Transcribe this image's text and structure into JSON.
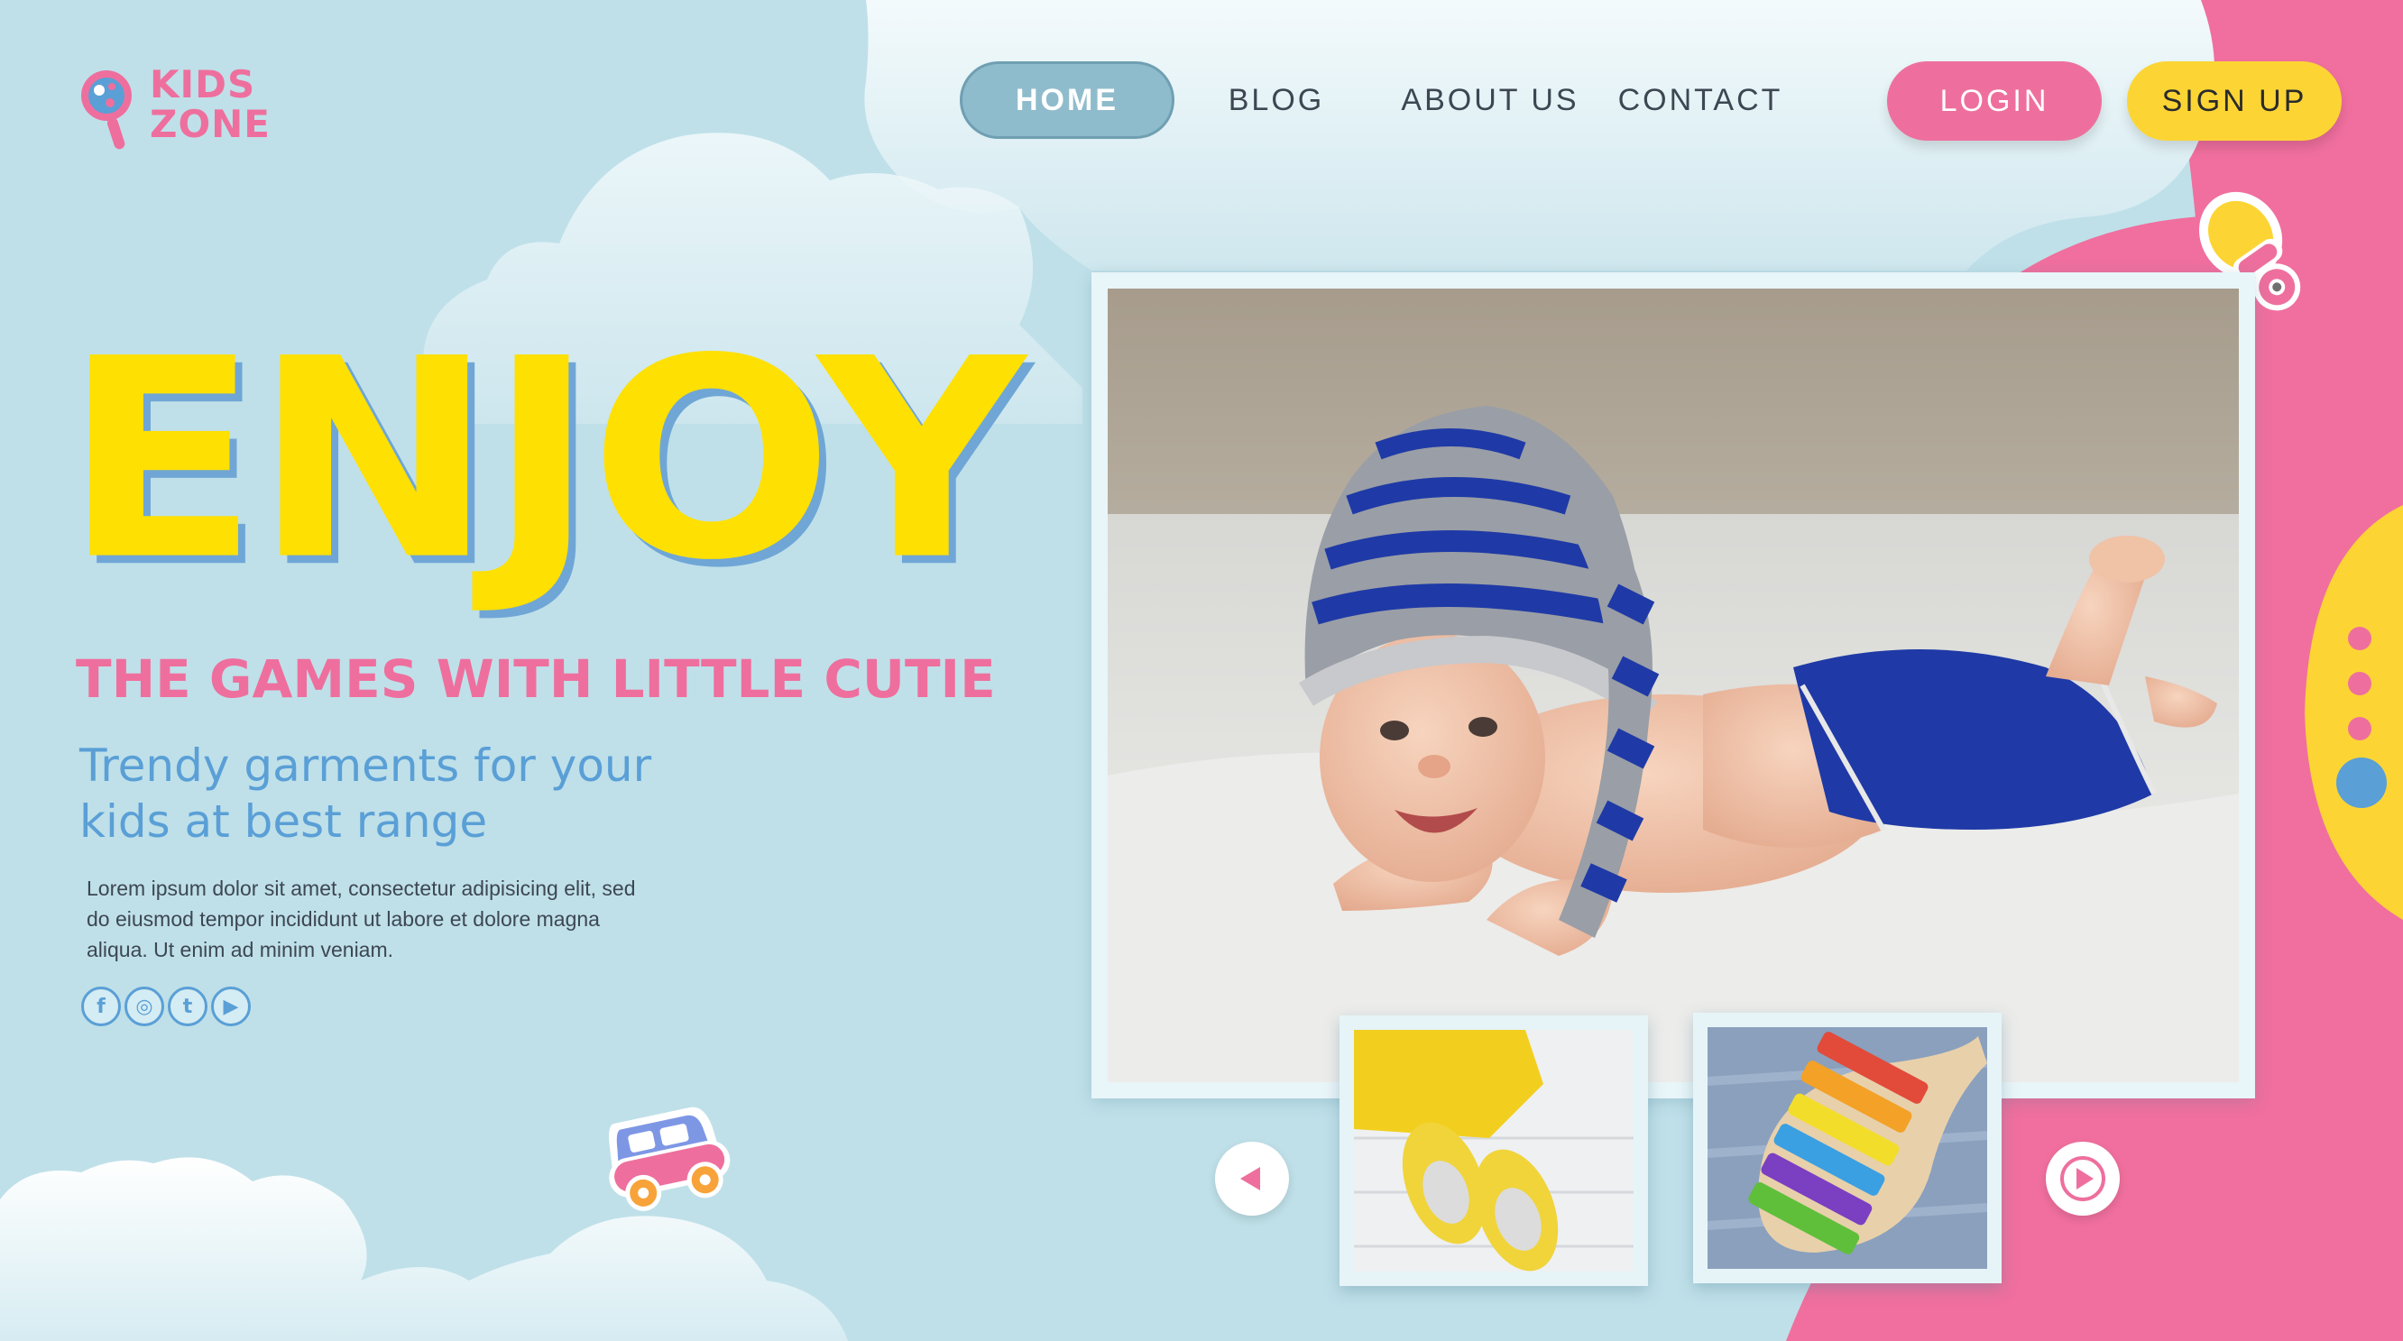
{
  "brand": {
    "line1": "KIDS",
    "line2": "ZONE"
  },
  "nav": {
    "home": "HOME",
    "blog": "BLOG",
    "about": "ABOUT US",
    "contact": "CONTACT"
  },
  "auth": {
    "login": "LOGIN",
    "signup": "SIGN UP"
  },
  "hero": {
    "headline": "ENJOY",
    "tagline": "THE GAMES WITH LITTLE CUTIE",
    "subtitle_line1": "Trendy garments for your",
    "subtitle_line2": "kids at best range",
    "body_line1": "Lorem ipsum dolor sit amet, consectetur adipisicing elit, sed",
    "body_line2": "do eiusmod tempor incididunt ut labore et dolore magna",
    "body_line3": "aliqua. Ut enim ad minim veniam."
  },
  "socials": [
    {
      "icon": "facebook-icon",
      "glyph": "f"
    },
    {
      "icon": "instagram-icon",
      "glyph": "◎"
    },
    {
      "icon": "twitter-icon",
      "glyph": "t"
    },
    {
      "icon": "youtube-icon",
      "glyph": "▶"
    }
  ],
  "colors": {
    "background": "#bfe0e9",
    "cloud": "#e4f3f7",
    "pink": "#ee6f9d",
    "yellow": "#fee003",
    "blue": "#5a9fd6",
    "nav_active": "#8fbccc"
  }
}
